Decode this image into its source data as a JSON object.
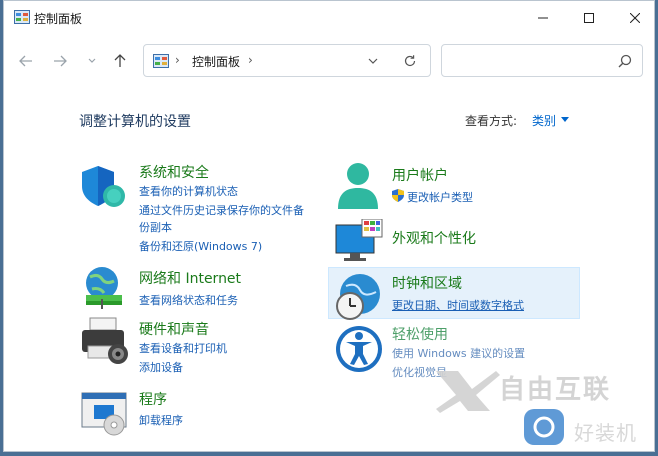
{
  "window": {
    "title": "控制面板"
  },
  "controls": {
    "minimize": "—",
    "maximize": "☐",
    "close": "✕"
  },
  "address": {
    "sep1": "›",
    "path": "控制面板",
    "sep2": "›"
  },
  "search": {
    "placeholder": ""
  },
  "page_title": "调整计算机的设置",
  "view": {
    "label": "查看方式:",
    "value": "类别"
  },
  "categories": [
    {
      "title": "系统和安全",
      "links": [
        "查看你的计算机状态",
        "通过文件历史记录保存你的文件备",
        "份副本",
        "备份和还原(Windows 7)"
      ]
    },
    {
      "title": "网络和 Internet",
      "links": [
        "查看网络状态和任务"
      ]
    },
    {
      "title": "硬件和声音",
      "links": [
        "查看设备和打印机",
        "添加设备"
      ]
    },
    {
      "title": "程序",
      "links": [
        "卸载程序"
      ]
    },
    {
      "title": "用户帐户",
      "links": [
        "更改帐户类型"
      ]
    },
    {
      "title": "外观和个性化",
      "links": []
    },
    {
      "title": "时钟和区域",
      "links": [
        "更改日期、时间或数字格式"
      ]
    },
    {
      "title": "轻松使用",
      "links": [
        "使用 Windows 建议的设置",
        "优化视觉显"
      ]
    }
  ],
  "watermark": {
    "text1": "自由互联",
    "text2": "好装机"
  }
}
